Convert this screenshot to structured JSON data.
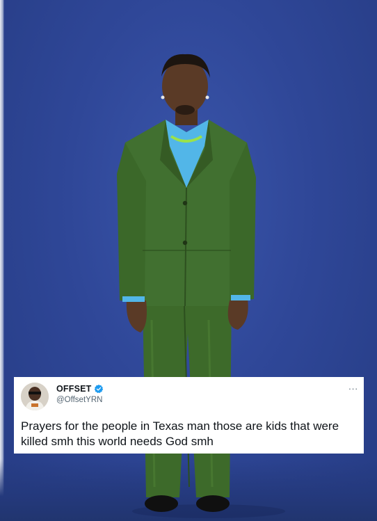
{
  "tweet": {
    "display_name": "OFFSET",
    "handle": "@OffsetYRN",
    "more_label": "...",
    "text": "Prayers for the people in Texas man those are kids that were killed smh this world needs God smh",
    "verified_icon": "verified-badge-icon",
    "verified_color": "#1d9bf0"
  },
  "photo": {
    "backdrop_color": "#2f4798",
    "suit_color": "#3f6a2c",
    "shirt_color": "#4fb4e6"
  }
}
